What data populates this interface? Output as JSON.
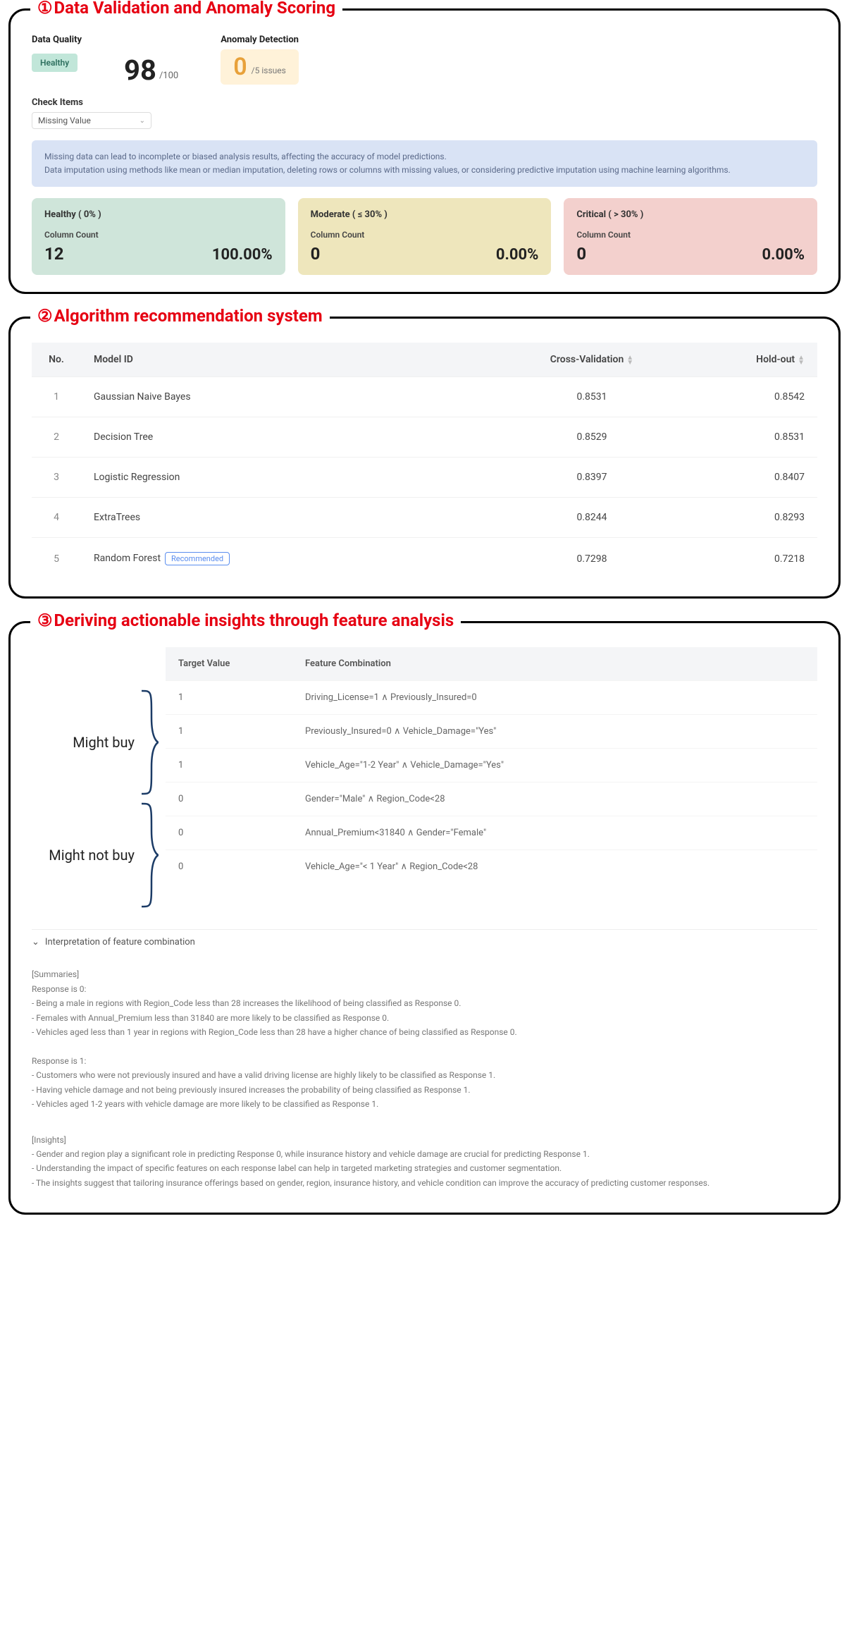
{
  "panel1": {
    "title": "Data Validation and Anomaly Scoring",
    "num": "①",
    "data_quality_label": "Data Quality",
    "healthy_badge": "Healthy",
    "score": "98",
    "score_max": "/100",
    "anomaly_label": "Anomaly Detection",
    "anomaly_num": "0",
    "anomaly_sub": "/5 issues",
    "check_items_label": "Check Items",
    "select_value": "Missing Value",
    "banner_l1": "Missing data can lead to incomplete or biased analysis results, affecting the accuracy of model predictions.",
    "banner_l2": "Data imputation using methods like mean or median imputation, deleting rows or columns with missing values, or considering predictive imputation using machine learning algorithms.",
    "cards": {
      "green": {
        "title": "Healthy ( 0% )",
        "sub": "Column Count",
        "count": "12",
        "pct": "100.00%"
      },
      "yellow": {
        "title": "Moderate ( ≤ 30% )",
        "sub": "Column Count",
        "count": "0",
        "pct": "0.00%"
      },
      "red": {
        "title": "Critical ( > 30% )",
        "sub": "Column Count",
        "count": "0",
        "pct": "0.00%"
      }
    }
  },
  "panel2": {
    "title": "Algorithm recommendation system",
    "num": "②",
    "h_no": "No.",
    "h_model": "Model ID",
    "h_cv": "Cross-Validation",
    "h_ho": "Hold-out",
    "rec_label": "Recommended",
    "rows": [
      {
        "no": "1",
        "model": "Gaussian Naive Bayes",
        "cv": "0.8531",
        "ho": "0.8542",
        "rec": false
      },
      {
        "no": "2",
        "model": "Decision Tree",
        "cv": "0.8529",
        "ho": "0.8531",
        "rec": false
      },
      {
        "no": "3",
        "model": "Logistic Regression",
        "cv": "0.8397",
        "ho": "0.8407",
        "rec": false
      },
      {
        "no": "4",
        "model": "ExtraTrees",
        "cv": "0.8244",
        "ho": "0.8293",
        "rec": false
      },
      {
        "no": "5",
        "model": "Random Forest",
        "cv": "0.7298",
        "ho": "0.7218",
        "rec": true
      }
    ]
  },
  "panel3": {
    "title": "Deriving actionable insights through feature analysis",
    "num": "③",
    "label_buy": "Might buy",
    "label_notbuy": "Might not buy",
    "h_tv": "Target Value",
    "h_fc": "Feature Combination",
    "rows": [
      {
        "tv": "1",
        "fc": "Driving_License=1 ∧ Previously_Insured=0"
      },
      {
        "tv": "1",
        "fc": "Previously_Insured=0 ∧ Vehicle_Damage=\"Yes\""
      },
      {
        "tv": "1",
        "fc": "Vehicle_Age=\"1-2 Year\" ∧ Vehicle_Damage=\"Yes\""
      },
      {
        "tv": "0",
        "fc": "Gender=\"Male\" ∧ Region_Code<28"
      },
      {
        "tv": "0",
        "fc": "Annual_Premium<31840 ∧ Gender=\"Female\""
      },
      {
        "tv": "0",
        "fc": "Vehicle_Age=\"< 1 Year\" ∧ Region_Code<28"
      }
    ],
    "accordion": "Interpretation of feature combination",
    "summaries_h": "[Summaries]",
    "r0_h": "Response is 0:",
    "r0_1": "- Being a male in regions with Region_Code less than 28 increases the likelihood of being classified as Response 0.",
    "r0_2": "- Females with Annual_Premium less than 31840 are more likely to be classified as Response 0.",
    "r0_3": "- Vehicles aged less than 1 year in regions with Region_Code less than 28 have a higher chance of being classified as Response 0.",
    "r1_h": "Response is 1:",
    "r1_1": "- Customers who were not previously insured and have a valid driving license are highly likely to be classified as Response 1.",
    "r1_2": "- Having vehicle damage and not being previously insured increases the probability of being classified as Response 1.",
    "r1_3": "- Vehicles aged 1-2 years with vehicle damage are more likely to be classified as Response 1.",
    "insights_h": "[Insights]",
    "i1": "- Gender and region play a significant role in predicting Response 0, while insurance history and vehicle damage are crucial for predicting Response 1.",
    "i2": "- Understanding the impact of specific features on each response label can help in targeted marketing strategies and customer segmentation.",
    "i3": "- The insights suggest that tailoring insurance offerings based on gender, region, insurance history, and vehicle condition can improve the accuracy of predicting customer responses."
  }
}
